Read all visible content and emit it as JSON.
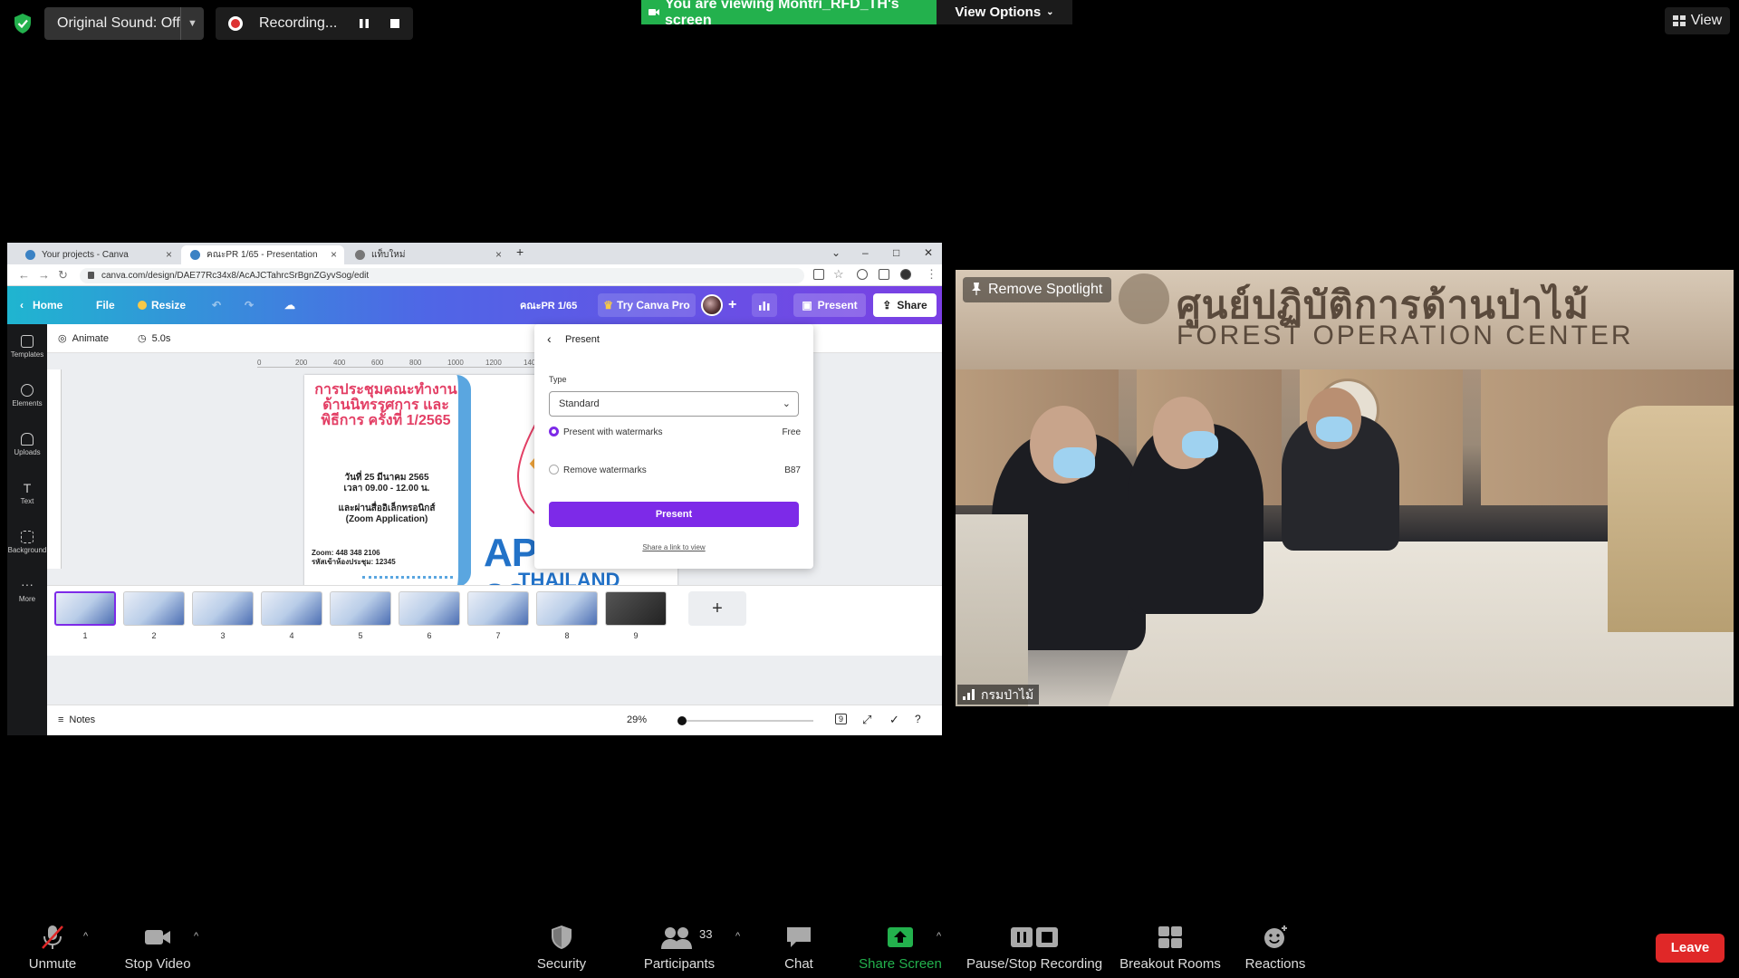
{
  "top_bar": {
    "original_sound": "Original Sound: Off",
    "recording": "Recording...",
    "viewing_banner": "You are viewing Montri_RFD_TH's screen",
    "view_options": "View Options",
    "view": "View"
  },
  "browser": {
    "tabs": [
      {
        "label": "Your projects - Canva"
      },
      {
        "label": "คณะPR 1/65 - Presentation"
      },
      {
        "label": "แท็บใหม่"
      }
    ],
    "url": "canva.com/design/DAE77Rc34x8/AcAJCTahrcSrBgnZGyvSog/edit"
  },
  "canva": {
    "home": "Home",
    "file": "File",
    "resize": "Resize",
    "doc_title": "คณะPR 1/65",
    "try_pro": "Try Canva Pro",
    "present": "Present",
    "share": "Share",
    "animate": "Animate",
    "duration": "5.0s",
    "rail": [
      {
        "label": "Templates",
        "icon": "templates-icon"
      },
      {
        "label": "Elements",
        "icon": "elements-icon"
      },
      {
        "label": "Uploads",
        "icon": "uploads-icon"
      },
      {
        "label": "Text",
        "icon": "text-icon"
      },
      {
        "label": "Background",
        "icon": "background-icon"
      },
      {
        "label": "More",
        "icon": "more-icon"
      }
    ],
    "ruler_ticks": [
      "0",
      "200",
      "400",
      "600",
      "800",
      "1000",
      "1200",
      "1400",
      "1600"
    ],
    "slide": {
      "title": "การประชุมคณะทำงาน ด้านนิทรรศการ และพิธีการ ครั้งที่ 1/2565",
      "date": "วันที่ 25 มีนาคม 2565",
      "time": "เวลา 09.00 - 12.00 น.",
      "via": "และผ่านสื่ออิเล็กทรอนิกส์",
      "app": "(Zoom Application)",
      "zoom_id": "Zoom: 448 348 2106",
      "passcode": "รหัสเข้าห้องประชุม: 12345",
      "apec": "APEC 2022",
      "thailand": "THAILAND"
    },
    "present_panel": {
      "title": "Present",
      "type_label": "Type",
      "type_value": "Standard",
      "option1": "Present with watermarks",
      "option1_price": "Free",
      "option2": "Remove watermarks",
      "option2_price": "B87",
      "button": "Present",
      "link": "Share a link to view"
    },
    "thumbnails": [
      "1",
      "2",
      "3",
      "4",
      "5",
      "6",
      "7",
      "8",
      "9"
    ],
    "notes": "Notes",
    "zoom_level": "29%",
    "page_count": "9"
  },
  "video": {
    "remove_spotlight": "Remove Spotlight",
    "participant_name": "กรมป่าไม้",
    "wall_text_th": "ศูนย์ปฏิบัติการด้านป่าไม้",
    "wall_text_en": "FOREST OPERATION CENTER"
  },
  "toolbar": {
    "unmute": "Unmute",
    "stop_video": "Stop Video",
    "security": "Security",
    "participants": "Participants",
    "participants_count": "33",
    "chat": "Chat",
    "share_screen": "Share Screen",
    "pause_stop_recording": "Pause/Stop Recording",
    "breakout_rooms": "Breakout Rooms",
    "reactions": "Reactions",
    "leave": "Leave"
  },
  "colors": {
    "banner_green": "#23b14d",
    "canva_purple": "#7d2ae8",
    "leave_red": "#e02828",
    "share_green": "#23b14d"
  }
}
